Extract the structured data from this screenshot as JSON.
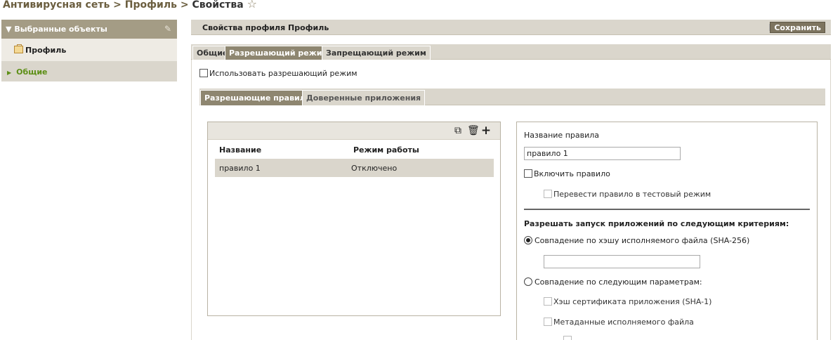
{
  "breadcrumb": {
    "root": "Антивирусная сеть",
    "separator": ">",
    "profile": "Профиль",
    "current": "Свойства",
    "star_icon": "☆"
  },
  "sidebar": {
    "header": "Выбранные объекты",
    "pin_icon": "pin-icon",
    "profile_label": "Профиль",
    "general_label": "Общие"
  },
  "props": {
    "title": "Свойства профиля Профиль",
    "save_label": "Сохранить"
  },
  "main_tabs": [
    {
      "label": "Общие",
      "active": false
    },
    {
      "label": "Разрешающий режим",
      "active": true
    },
    {
      "label": "Запрещающий режим",
      "active": false
    }
  ],
  "use_allow_mode": {
    "label": "Использовать разрешающий режим",
    "checked": false
  },
  "sub_tabs": [
    {
      "label": "Разрешающие правила",
      "active": true
    },
    {
      "label": "Доверенные приложения",
      "active": false
    }
  ],
  "rules": {
    "columns": [
      "Название",
      "Режим работы"
    ],
    "rows": [
      {
        "name": "правило 1",
        "mode": "Отключено"
      }
    ]
  },
  "details": {
    "rule_name_label": "Название правила",
    "rule_name_value": "правило 1",
    "enable_rule_label": "Включить правило",
    "test_mode_label": "Перевести правило в тестовый режим",
    "criteria_heading": "Разрешать запуск приложений по следующим критериям:",
    "hash_match_label": "Совпадение по хэшу исполняемого файла (SHA-256)",
    "hash_value": "",
    "params_match_label": "Совпадение по следующим параметрам:",
    "cert_hash_label": "Хэш сертификата приложения (SHA-1)",
    "metadata_label": "Метаданные исполняемого файла",
    "selected_criterion": "hash"
  },
  "colors": {
    "sidebar_header": "#a49c85",
    "active_tab": "#8e8670",
    "tabbar": "#dad6cc",
    "breadcrumb_link": "#6b5e3f",
    "general_green": "#5d8f16"
  }
}
